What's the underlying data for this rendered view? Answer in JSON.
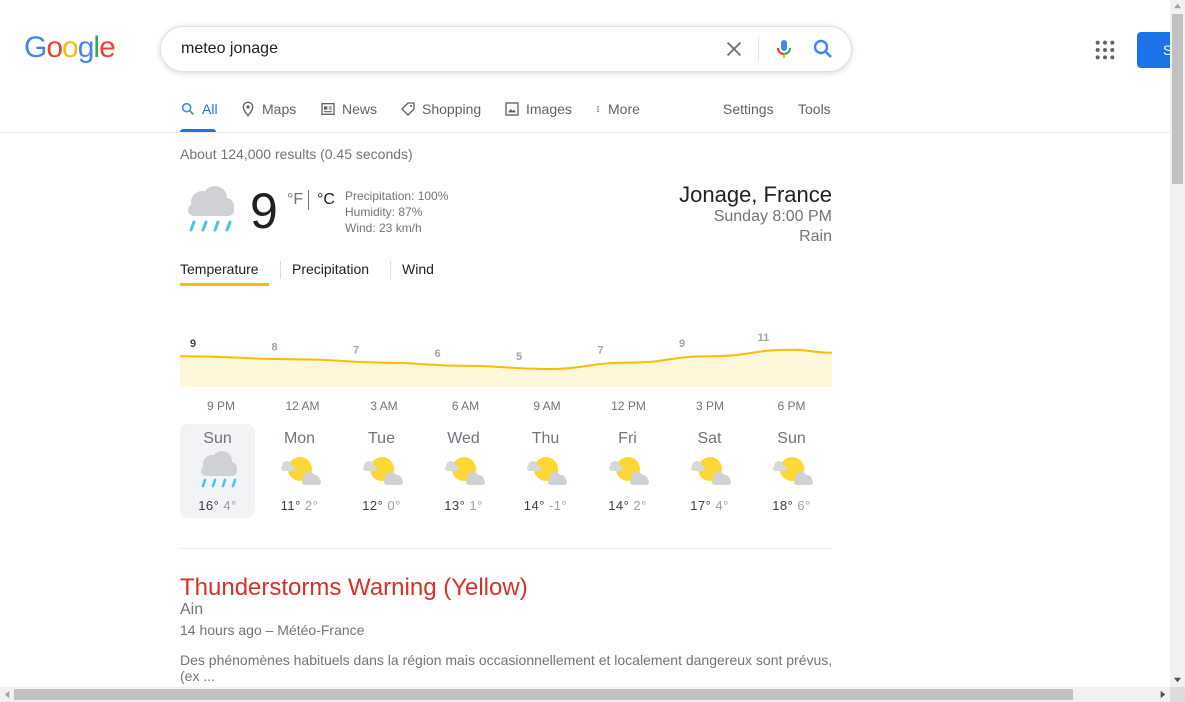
{
  "logo": {
    "letters": [
      "G",
      "o",
      "o",
      "g",
      "l",
      "e"
    ],
    "colors": [
      "#4285f4",
      "#ea4335",
      "#fbbc05",
      "#4285f4",
      "#34a853",
      "#ea4335"
    ]
  },
  "search": {
    "query": "meteo jonage"
  },
  "header": {
    "signin_label": "S"
  },
  "tabs": {
    "all": "All",
    "maps": "Maps",
    "news": "News",
    "shopping": "Shopping",
    "images": "Images",
    "more": "More",
    "settings": "Settings",
    "tools": "Tools"
  },
  "result_stats": "About 124,000 results (0.45 seconds)",
  "weather": {
    "temperature": "9",
    "unit_f": "°F",
    "unit_c": "°C",
    "precipitation": "Precipitation: 100%",
    "humidity": "Humidity: 87%",
    "wind": "Wind: 23 km/h",
    "location": "Jonage, France",
    "time": "Sunday 8:00 PM",
    "condition": "Rain",
    "tabs": {
      "temperature": "Temperature",
      "precipitation": "Precipitation",
      "wind": "Wind"
    },
    "hourly_temps": [
      9,
      8,
      7,
      6,
      5,
      7,
      9,
      11
    ],
    "hour_labels": [
      "9 PM",
      "12 AM",
      "3 AM",
      "6 AM",
      "9 AM",
      "12 PM",
      "3 PM",
      "6 PM"
    ],
    "days": [
      {
        "name": "Sun",
        "hi": "16°",
        "lo": "4°",
        "icon": "rain-icon",
        "selected": true
      },
      {
        "name": "Mon",
        "hi": "11°",
        "lo": "2°",
        "icon": "partly-cloudy-icon"
      },
      {
        "name": "Tue",
        "hi": "12°",
        "lo": "0°",
        "icon": "partly-cloudy-icon"
      },
      {
        "name": "Wed",
        "hi": "13°",
        "lo": "1°",
        "icon": "partly-cloudy-icon"
      },
      {
        "name": "Thu",
        "hi": "14°",
        "lo": "-1°",
        "icon": "partly-cloudy-icon"
      },
      {
        "name": "Fri",
        "hi": "14°",
        "lo": "2°",
        "icon": "partly-cloudy-icon"
      },
      {
        "name": "Sat",
        "hi": "17°",
        "lo": "4°",
        "icon": "partly-cloudy-icon"
      },
      {
        "name": "Sun",
        "hi": "18°",
        "lo": "6°",
        "icon": "partly-cloudy-icon"
      }
    ]
  },
  "warning": {
    "title": "Thunderstorms Warning (Yellow)",
    "region": "Ain",
    "meta": "14 hours ago – Météo-France",
    "description": "Des phénomènes habituels dans la région mais occasionnellement et localement dangereux sont prévus, (ex ..."
  },
  "colors": {
    "accent": "#1a73e8",
    "chart_line": "#fbbc04",
    "chart_fill": "#fef7d9",
    "warning": "#d93025"
  }
}
